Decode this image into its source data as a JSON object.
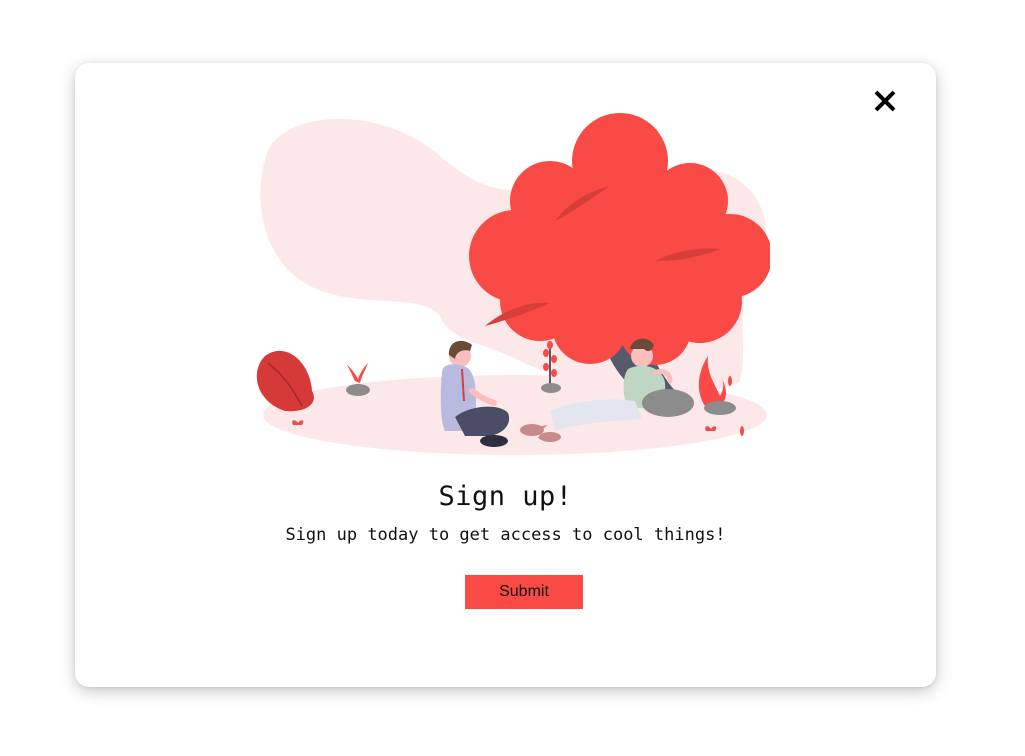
{
  "modal": {
    "close_icon": "close-icon",
    "title": "Sign up!",
    "subtitle": "Sign up today to get access to cool things!",
    "submit_label": "Submit"
  },
  "illustration": {
    "description_icon": "two-people-under-tree-illustration"
  },
  "colors": {
    "accent": "#f94a45",
    "blob": "#fde8e9",
    "trunk": "#575a6b",
    "text": "#111111"
  }
}
